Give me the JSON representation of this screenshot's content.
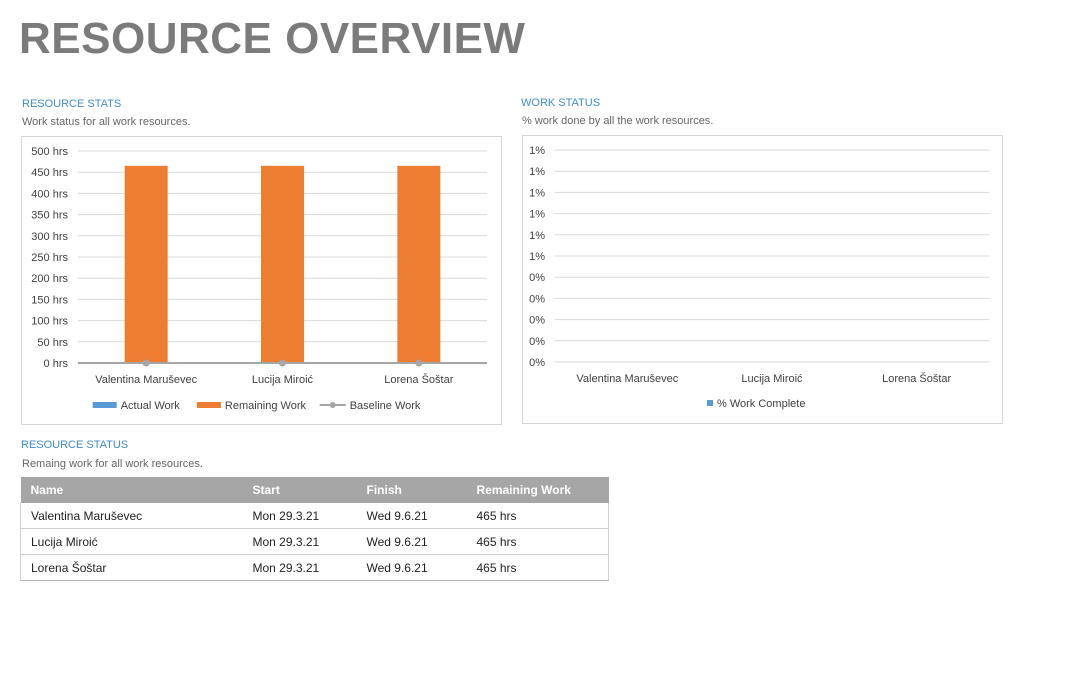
{
  "page": {
    "title": "RESOURCE OVERVIEW"
  },
  "resource_stats": {
    "title": "RESOURCE STATS",
    "subtitle": "Work status for all work resources."
  },
  "work_status": {
    "title": "WORK STATUS",
    "subtitle": "% work done by all the work resources."
  },
  "resource_status": {
    "title": "RESOURCE STATUS",
    "subtitle": "Remaing work for all work resources.",
    "columns": [
      "Name",
      "Start",
      "Finish",
      "Remaining Work"
    ],
    "rows": [
      [
        "Valentina Maruševec",
        "Mon 29.3.21",
        "Wed 9.6.21",
        "465 hrs"
      ],
      [
        "Lucija Miroić",
        "Mon 29.3.21",
        "Wed 9.6.21",
        "465 hrs"
      ],
      [
        "Lorena Šoštar",
        "Mon 29.3.21",
        "Wed 9.6.21",
        "465 hrs"
      ]
    ]
  },
  "colors": {
    "actual": "#5b9bd5",
    "remaining": "#ed7d31",
    "baseline": "#a5a5a5",
    "pct": "#5b9bd5",
    "grid": "#d9d9d9",
    "axis_text": "#404040"
  },
  "chart_data": [
    {
      "type": "bar",
      "categories": [
        "Valentina Maruševec",
        "Lucija Miroić",
        "Lorena Šoštar"
      ],
      "series": [
        {
          "name": "Actual Work",
          "values": [
            0,
            0,
            0
          ],
          "kind": "bar"
        },
        {
          "name": "Remaining Work",
          "values": [
            465,
            465,
            465
          ],
          "kind": "bar"
        },
        {
          "name": "Baseline Work",
          "values": [
            0,
            0,
            0
          ],
          "kind": "line"
        }
      ],
      "y_ticks": [
        "0 hrs",
        "50 hrs",
        "100 hrs",
        "150 hrs",
        "200 hrs",
        "250 hrs",
        "300 hrs",
        "350 hrs",
        "400 hrs",
        "450 hrs",
        "500 hrs"
      ],
      "ylim": [
        0,
        500
      ],
      "legend": "bottom",
      "grid": true
    },
    {
      "type": "bar",
      "categories": [
        "Valentina Maruševec",
        "Lucija Miroić",
        "Lorena Šoštar"
      ],
      "series": [
        {
          "name": "% Work Complete",
          "values": [
            0,
            0,
            0
          ]
        }
      ],
      "y_ticks": [
        "0%",
        "0%",
        "0%",
        "0%",
        "0%",
        "1%",
        "1%",
        "1%",
        "1%",
        "1%",
        "1%"
      ],
      "ylim": [
        0,
        1
      ],
      "legend": "bottom",
      "grid": true
    }
  ]
}
